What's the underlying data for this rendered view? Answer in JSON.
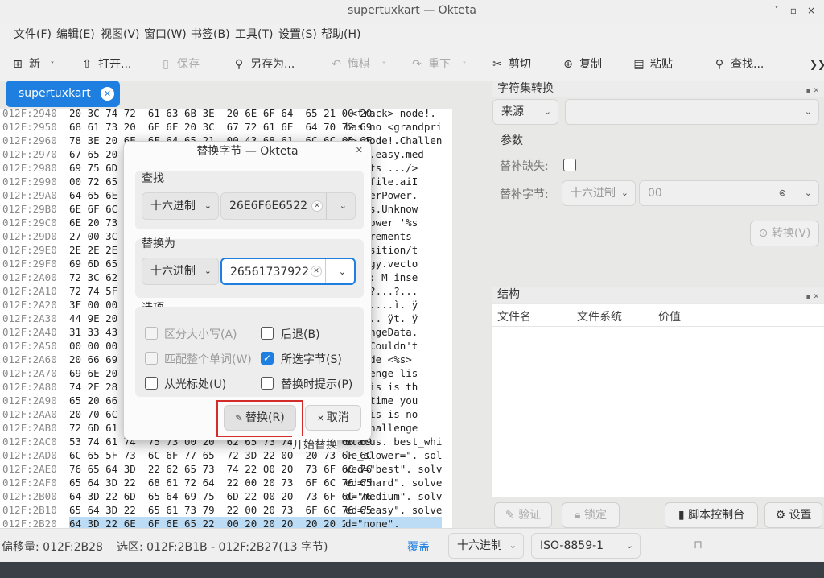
{
  "window": {
    "title": "supertuxkart — Okteta",
    "min": "˅",
    "max": "▫",
    "close": "×"
  },
  "menu": [
    "文件(F)",
    "编辑(E)",
    "视图(V)",
    "窗口(W)",
    "书签(B)",
    "工具(T)",
    "设置(S)",
    "帮助(H)"
  ],
  "toolbar": {
    "new": "新",
    "open": "打开...",
    "save": "保存",
    "save_as": "另存为...",
    "undo": "悔棋",
    "redo": "重下",
    "cut": "剪切",
    "copy": "复制",
    "paste": "粘贴",
    "find": "查找...",
    "more": "❯❯"
  },
  "tab": {
    "label": "supertuxkart"
  },
  "hex": {
    "rows": [
      {
        "off": "012F:2940",
        "hex": "20 3C 74 72  61 63 6B 3E  20 6E 6F 64  65 21 00 20",
        "asc": " <track> node!. "
      },
      {
        "off": "012F:2950",
        "hex": "68 61 73 20  6E 6F 20 3C  67 72 61 6E  64 70 72 69",
        "asc": "has no <grandpri"
      },
      {
        "off": "012F:2960",
        "hex": "78 3E 20 6E  6F 64 65 21  00 43 68 61  6C 6C 65 6E",
        "asc": "x> node!.Challen"
      },
      {
        "off": "012F:2970",
        "hex": "67 65 20 44",
        "asc": "data.easy.med"
      },
      {
        "off": "012F:2980",
        "hex": "69 75 6D 00",
        "asc": "<karts .../>"
      },
      {
        "off": "012F:2990",
        "hex": "00 72 65 70",
        "asc": "lay_file.aiI"
      },
      {
        "off": "012F:29A0",
        "hex": "64 65 6E 74",
        "asc": ".superPower."
      },
      {
        "off": "012F:29B0",
        "hex": "6E 6F 6C 6",
        "asc": "kBoss.Unknow"
      },
      {
        "off": "012F:29C0",
        "hex": "6E 20 73 75",
        "asc": "perpower '%s"
      },
      {
        "off": "012F:29D0",
        "hex": "27 00 3C 73",
        "asc": "equirements"
      },
      {
        "off": "012F:29E0",
        "hex": "2E 2E 2E 2",
        "asc": ">.position/t"
      },
      {
        "off": "012F:29F0",
        "hex": "69 6D 65 00",
        "asc": "energy.vecto"
      },
      {
        "off": "012F:2A00",
        "hex": "72 3C 62 6",
        "asc": "ol>::_M_inse"
      },
      {
        "off": "012F:2A10",
        "hex": "72 74 5F 6",
        "asc": "ux..?...?..."
      },
      {
        "off": "012F:2A20",
        "hex": "3F 00 00 00",
        "asc": "?.......ì. ÿ"
      },
      {
        "off": "012F:2A30",
        "hex": "44 9E 20 F",
        "asc": "ô. ÿ.. ÿt. ÿ"
      },
      {
        "off": "012F:2A40",
        "hex": "31 33 43 6",
        "asc": "allengeData."
      },
      {
        "off": "012F:2A50",
        "hex": "00 00 00 0",
        "asc": "....Couldn't"
      },
      {
        "off": "012F:2A60",
        "hex": "20 66 69 6",
        "asc": "d node <%s>"
      },
      {
        "off": "012F:2A70",
        "hex": "69 6E 20 6",
        "asc": "hallenge lis"
      },
      {
        "off": "012F:2A80",
        "hex": "74 2E 28 4",
        "asc": "f this is th"
      },
      {
        "off": "012F:2A90",
        "hex": "65 20 66 6",
        "asc": "rst time you"
      },
      {
        "off": "012F:2AA0",
        "hex": "20 70 6C 6",
        "asc": "y this is no"
      },
      {
        "off": "012F:2AB0",
        "hex": "72 6D 61 6",
        "asc": ")..Challenge"
      },
      {
        "off": "012F:2AC0",
        "hex": "53 74 61 74  75 73 00 20  62 65 73 74  5F 77 68 69",
        "asc": "Status. best_whi"
      },
      {
        "off": "012F:2AD0",
        "hex": "6C 65 5F 73  6C 6F 77 65  72 3D 22 00  20 73 6F 6C",
        "asc": "le_slower=\". sol"
      },
      {
        "off": "012F:2AE0",
        "hex": "76 65 64 3D  22 62 65 73  74 22 00 20  73 6F 6C 76",
        "asc": "ved=\"best\". solv"
      },
      {
        "off": "012F:2AF0",
        "hex": "65 64 3D 22  68 61 72 64  22 00 20 73  6F 6C 76 65",
        "asc": "ed=\"hard\". solve"
      },
      {
        "off": "012F:2B00",
        "hex": "64 3D 22 6D  65 64 69 75  6D 22 00 20  73 6F 6C 76",
        "asc": "d=\"medium\". solv"
      },
      {
        "off": "012F:2B10",
        "hex": "65 64 3D 22  65 61 73 79  22 00 20 73  6F 6C 76 65",
        "asc": "ed=\"easy\". solve"
      },
      {
        "off": "012F:2B20",
        "hex": "64 3D 22 6E  6F 6E 65 22  00 20 20 20  20 20 20 20",
        "asc": "d=\"none\".       "
      }
    ]
  },
  "charset": {
    "title": "字符集转换",
    "source": "来源",
    "params": "参数",
    "missing_label": "替补缺失:",
    "sub_label": "替补字节:",
    "sub_mode": "十六进制",
    "sub_value": "00",
    "convert": "转换(V)"
  },
  "structure": {
    "title": "结构",
    "cols": [
      "文件名",
      "文件系统",
      "价值"
    ],
    "validate": "验证",
    "lock": "锁定",
    "console": "脚本控制台",
    "settings": "设置"
  },
  "status": {
    "offset": "偏移量: 012F:2B28",
    "selection": "选区: 012F:2B1B - 012F:2B27(13 字节)",
    "mode": "覆盖",
    "encoding_mode": "十六进制",
    "charset": "ISO-8859-1"
  },
  "dialog": {
    "title": "替换字节 — Okteta",
    "find_title": "查找",
    "find_mode": "十六进制",
    "find_value": "26E6F6E6522",
    "replace_title": "替换为",
    "replace_mode": "十六进制",
    "replace_value": "26561737922",
    "options_title": "选项",
    "opt_case": "区分大小写(A)",
    "opt_back": "后退(B)",
    "opt_whole": "匹配整个单词(W)",
    "opt_sel": "所选字节(S)",
    "opt_cursor": "从光标处(U)",
    "opt_prompt": "替换时提示(P)",
    "replace_btn": "替换(R)",
    "cancel_btn": "取消",
    "tooltip": "开始替换"
  }
}
